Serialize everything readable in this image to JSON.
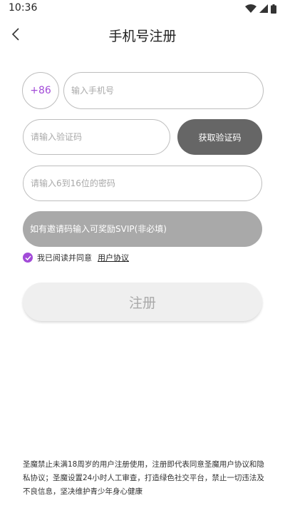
{
  "status_bar": {
    "time": "10:36",
    "icons": [
      "wifi-icon",
      "signal-icon",
      "battery-icon"
    ]
  },
  "header": {
    "title": "手机号注册",
    "back_icon": "chevron-left-icon"
  },
  "form": {
    "country_code": "+86",
    "phone_placeholder": "输入手机号",
    "code_placeholder": "请输入验证码",
    "get_code_label": "获取验证码",
    "password_placeholder": "请输入6到16位的密码",
    "invite_placeholder": "如有邀请码输入可奖励SVIP(非必填)",
    "agree_text": "我已阅读并同意",
    "agreement_link": "用户协议",
    "agree_checked": true,
    "register_label": "注册"
  },
  "disclaimer": "圣魔禁止未满18周岁的用户注册使用，注册即代表同意圣魔用户协议和隐私协议；圣魔设置24小时人工审查，打造绿色社交平台，禁止一切违法及不良信息，坚决维护青少年身心健康",
  "colors": {
    "accent": "#a24bd8",
    "get_code_bg": "#666666",
    "invite_bg": "#a9a9a9",
    "register_bg": "#efefef"
  }
}
